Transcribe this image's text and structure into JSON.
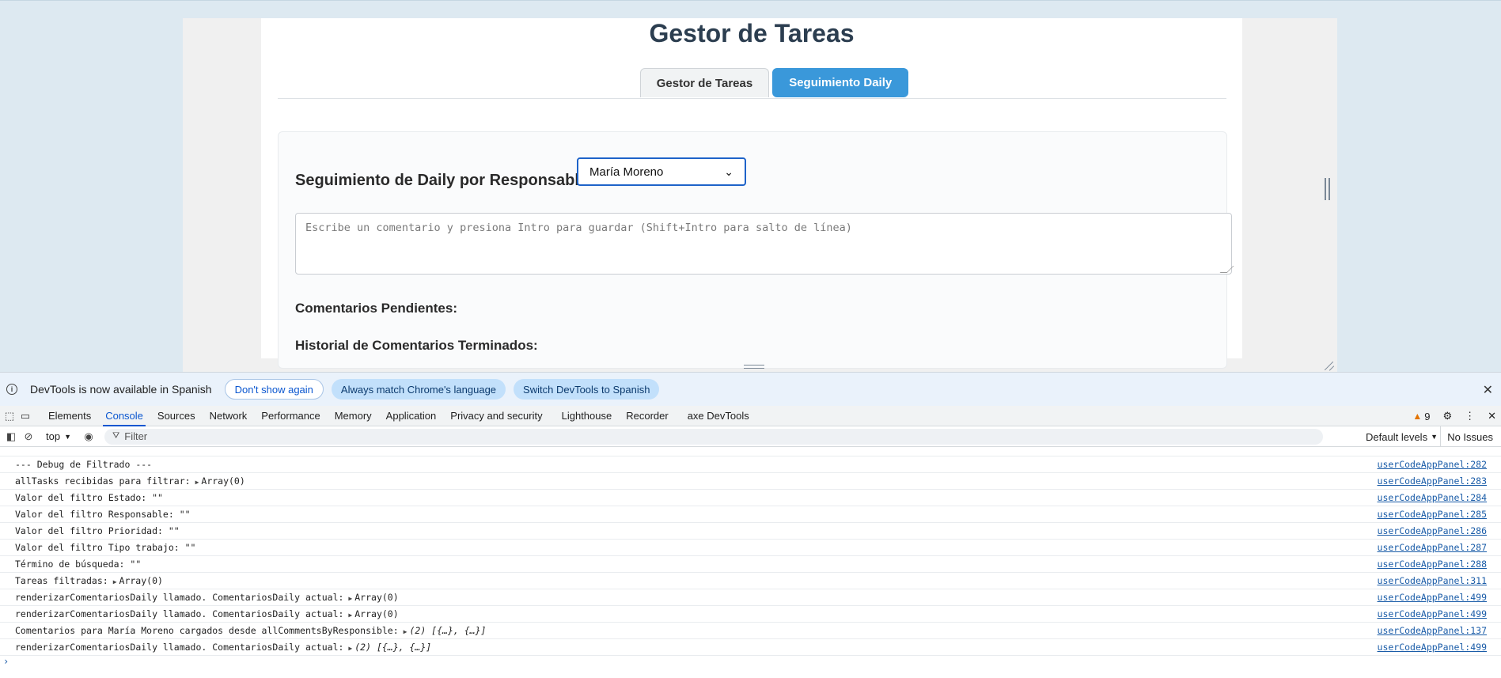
{
  "app": {
    "title": "Gestor de Tareas",
    "tabs": [
      {
        "label": "Gestor de Tareas",
        "active": false
      },
      {
        "label": "Seguimiento Daily",
        "active": true
      }
    ],
    "daily": {
      "heading": "Seguimiento de Daily por Responsable",
      "selected_responsable": "María Moreno",
      "comment_placeholder": "Escribe un comentario y presiona Intro para guardar (Shift+Intro para salto de línea)",
      "pending_heading": "Comentarios Pendientes:",
      "history_heading": "Historial de Comentarios Terminados:"
    },
    "accent_color": "#3a98da"
  },
  "devtools": {
    "infobar": {
      "message": "DevTools is now available in Spanish",
      "btn_dont_show": "Don't show again",
      "btn_match_language": "Always match Chrome's language",
      "btn_switch": "Switch DevTools to Spanish"
    },
    "tabs": [
      "Elements",
      "Console",
      "Sources",
      "Network",
      "Performance",
      "Memory",
      "Application",
      "Privacy and security",
      "Lighthouse",
      "Recorder",
      "axe DevTools"
    ],
    "selected_tab": "Console",
    "warning_count": "9",
    "toolbar": {
      "context": "top",
      "filter_placeholder": "Filter",
      "levels": "Default levels",
      "issues": "No Issues"
    },
    "console_rows": [
      {
        "msg": "--- Debug de Filtrado ---",
        "arr": "",
        "src": "userCodeAppPanel:282"
      },
      {
        "msg": "allTasks recibidas para filtrar:",
        "arr": "Array(0)",
        "src": "userCodeAppPanel:283"
      },
      {
        "msg": "Valor del filtro Estado: \"\"",
        "arr": "",
        "src": "userCodeAppPanel:284"
      },
      {
        "msg": "Valor del filtro Responsable: \"\"",
        "arr": "",
        "src": "userCodeAppPanel:285"
      },
      {
        "msg": "Valor del filtro Prioridad: \"\"",
        "arr": "",
        "src": "userCodeAppPanel:286"
      },
      {
        "msg": "Valor del filtro Tipo trabajo: \"\"",
        "arr": "",
        "src": "userCodeAppPanel:287"
      },
      {
        "msg": "Término de búsqueda: \"\"",
        "arr": "",
        "src": "userCodeAppPanel:288"
      },
      {
        "msg": "Tareas filtradas:",
        "arr": "Array(0)",
        "src": "userCodeAppPanel:311"
      },
      {
        "msg": "renderizarComentariosDaily llamado. ComentariosDaily actual:",
        "arr": "Array(0)",
        "src": "userCodeAppPanel:499"
      },
      {
        "msg": "renderizarComentariosDaily llamado. ComentariosDaily actual:",
        "arr": "Array(0)",
        "src": "userCodeAppPanel:499"
      },
      {
        "msg": "Comentarios para María Moreno cargados desde allCommentsByResponsible:",
        "arr": "(2) [{…}, {…}]",
        "italic": true,
        "src": "userCodeAppPanel:137"
      },
      {
        "msg": "renderizarComentariosDaily llamado. ComentariosDaily actual:",
        "arr": "(2) [{…}, {…}]",
        "italic": true,
        "src": "userCodeAppPanel:499"
      }
    ],
    "prompt": "›"
  }
}
